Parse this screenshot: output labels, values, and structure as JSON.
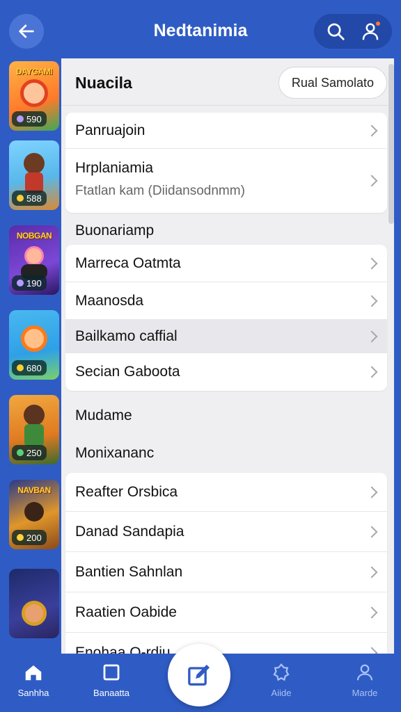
{
  "header": {
    "title": "Nedtanimia"
  },
  "games": [
    {
      "banner": "DAYGAMI",
      "value": "590"
    },
    {
      "banner": "",
      "value": "588"
    },
    {
      "banner": "NOBGAN",
      "value": "190"
    },
    {
      "banner": "",
      "value": "680"
    },
    {
      "banner": "",
      "value": "250"
    },
    {
      "banner": "NAVBAN",
      "value": "200"
    },
    {
      "banner": "",
      "value": ""
    }
  ],
  "panel": {
    "title": "Nuacila",
    "chip": "Rual Samolato"
  },
  "group1": [
    {
      "label": "Panruajoin"
    },
    {
      "label": "Hrplaniamia",
      "sub": "Ftatlan kam (Diidansodnmm)"
    }
  ],
  "section1": "Buonariamp",
  "group2": [
    {
      "label": "Marreca Oatmta"
    },
    {
      "label": "Maanosda"
    },
    {
      "label": "Bailkamo caffial"
    },
    {
      "label": "Secian Gaboota"
    }
  ],
  "section2": "Mudame",
  "section3": "Monixananc",
  "group3": [
    {
      "label": "Reafter Orsbica"
    },
    {
      "label": "Danad Sandapia"
    },
    {
      "label": "Bantien Sahnlan"
    },
    {
      "label": "Raatien Oabide"
    },
    {
      "label": "Enohaa O-rdiu"
    }
  ],
  "nav": {
    "items": [
      {
        "label": "Sanhha"
      },
      {
        "label": "Banaatta"
      },
      {
        "label": "Aiide"
      },
      {
        "label": "Marde"
      }
    ]
  },
  "colors": {
    "brand": "#2f5cc4",
    "panel": "#efeff1",
    "accent_dot": "#ff7a30"
  }
}
